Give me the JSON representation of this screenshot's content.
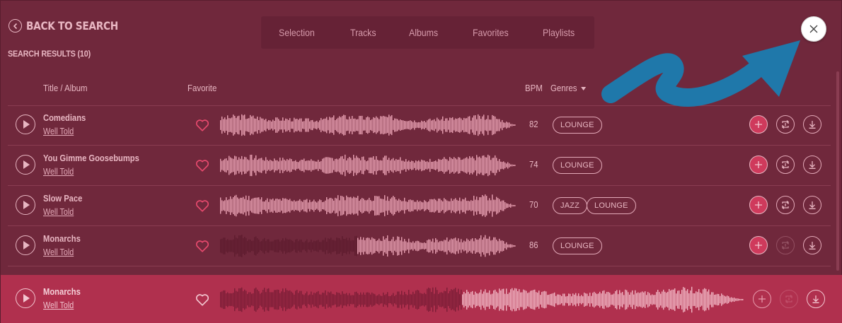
{
  "back_label": "BACK TO SEARCH",
  "results_label": "SEARCH RESULTS (10)",
  "tabs": [
    {
      "label": "Selection"
    },
    {
      "label": "Tracks"
    },
    {
      "label": "Albums"
    },
    {
      "label": "Favorites"
    },
    {
      "label": "Playlists"
    }
  ],
  "columns": {
    "title": "Title / Album",
    "favorite": "Favorite",
    "bpm": "BPM",
    "genres": "Genres"
  },
  "tracks": [
    {
      "title": "Comedians",
      "album": "Well Told",
      "bpm": "82",
      "genres": [
        "LOUNGE"
      ]
    },
    {
      "title": "You Gimme Goosebumps",
      "album": "Well Told",
      "bpm": "74",
      "genres": [
        "LOUNGE"
      ]
    },
    {
      "title": "Slow Pace",
      "album": "Well Told",
      "bpm": "70",
      "genres": [
        "JAZZ",
        "LOUNGE"
      ]
    },
    {
      "title": "Monarchs",
      "album": "Well Told",
      "bpm": "86",
      "genres": [
        "LOUNGE"
      ]
    }
  ],
  "player": {
    "title": "Monarchs",
    "album": "Well Told",
    "progress": 0.46
  },
  "icons": {
    "back": "chevron-left-circle-icon",
    "close": "close-icon",
    "play": "play-icon",
    "favorite": "heart-outline-icon",
    "add": "plus-icon",
    "loop": "loop-icon",
    "download": "download-icon"
  },
  "colors": {
    "background": "#70283c",
    "accent": "#cf3a5c",
    "player": "#b0304e",
    "annotation_arrow": "#1f78aa"
  }
}
